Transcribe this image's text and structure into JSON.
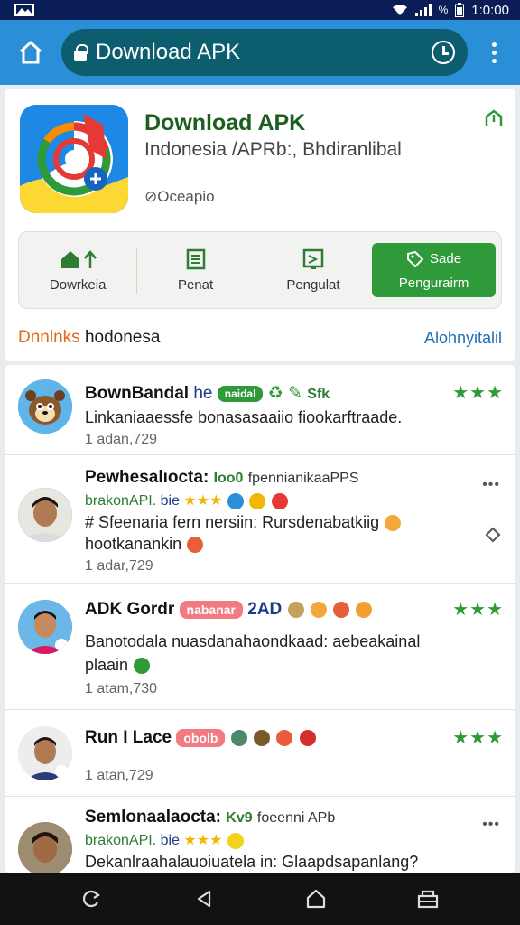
{
  "status_bar": {
    "time": "1:0:00"
  },
  "browser": {
    "url_title": "Download APK"
  },
  "app": {
    "title": "Download APK",
    "subtitle": "Indonesia /APRb:, Bhdiranlibal",
    "meta": "Oceapio",
    "actions": [
      {
        "label": "Dowrkeia",
        "icon": "home-upload-icon"
      },
      {
        "label": "Penat",
        "icon": "document-icon"
      },
      {
        "label": "Pengulat",
        "icon": "image-icon"
      },
      {
        "top": "Sade",
        "label": "Pengurairm",
        "icon": "tag-icon"
      }
    ],
    "footer_left_orange": "Dnnlnks",
    "footer_left_rest": "hodonesa",
    "footer_right": "Alohnyitalil"
  },
  "comments": [
    {
      "name": "BownBandal",
      "name_suffix": "he",
      "badge": "naidal",
      "tag": "Sfk",
      "text": "Linkaniaaessfe bonasasaaiio fiookarftraade.",
      "time": "1 adan,729",
      "stars": "★★★"
    },
    {
      "name": "Pewhesalıocta:",
      "name_tag": "Ioo0",
      "name_rest": "fpennianikaaPPS",
      "line2_tag": "brakonAPI.",
      "line2_rest": "bie",
      "line2_stars": "★★★",
      "text1": "# Sfeenaria fern nersiin: Rursdenabatkiig",
      "text2": "hootkanankin",
      "time": "1 adar,729",
      "more": "•••"
    },
    {
      "name": "ADK Gordr",
      "badge": "nabanar",
      "badge_after": "2AD",
      "text1": "Banotodala nuasdanahaondkaad: aebeakainal",
      "text2": "plaain",
      "time": "1 atam,730",
      "stars": "★★★"
    },
    {
      "name": "Run I Lace",
      "badge": "obolb",
      "time": "1 atan,729",
      "stars": "★★★"
    },
    {
      "name": "Semlonaalaocta:",
      "name_tag": "Kv9",
      "name_rest": "foeenni APb",
      "line2_tag": "brakonAPI.",
      "line2_rest": "bie",
      "line2_stars": "★★★",
      "text1": "Dekanlraahalauoiuatela in: Glaapdsapanlang?",
      "more": "•••"
    }
  ],
  "colors": {
    "accent_green": "#2e9a3a",
    "browser_blue": "#2a8fd6",
    "url_teal": "#0c5d6e",
    "link_blue": "#1e6fb8",
    "orange": "#e0691b"
  }
}
